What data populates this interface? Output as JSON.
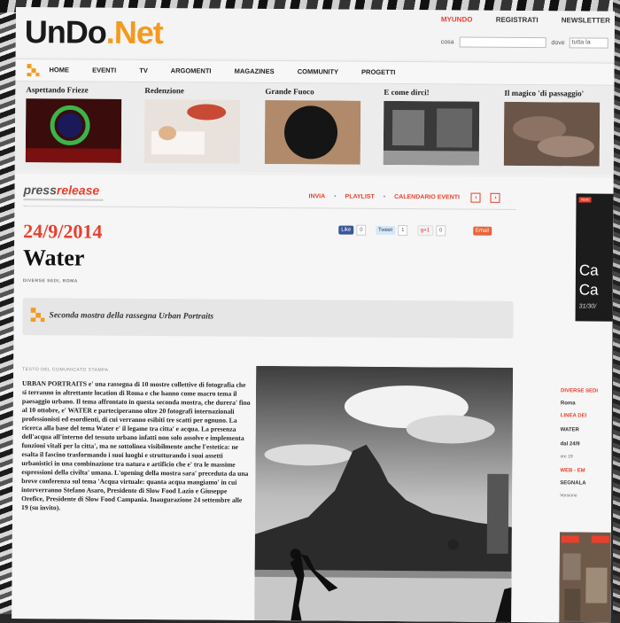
{
  "header": {
    "logo_main": "UnDo",
    "logo_suffix": ".Net",
    "top_links": [
      "MYUNDO",
      "REGISTRATI",
      "NEWSLETTER"
    ],
    "search_label": "cosa",
    "where_label": "dove",
    "where_value": "tutta la"
  },
  "nav": {
    "items": [
      "HOME",
      "EVENTI",
      "TV",
      "ARGOMENTI",
      "MAGAZINES",
      "COMMUNITY",
      "PROGETTI"
    ]
  },
  "features": [
    {
      "title": "Aspettando Frieze"
    },
    {
      "title": "Redenzione"
    },
    {
      "title": "Grande Fuoco"
    },
    {
      "title": "E come dirci!"
    },
    {
      "title": "Il magico 'di passaggio'"
    }
  ],
  "press": {
    "brand_a": "press",
    "brand_b": "release",
    "actions": [
      "INVIA",
      "PLAYLIST",
      "CALENDARIO EVENTI"
    ]
  },
  "article": {
    "date": "24/9/2014",
    "title": "Water",
    "place": "DIVERSE SEDI, ROMA",
    "subtitle": "Seconda mostra della rassegna Urban Portraits",
    "comm_label": "TESTO DEL COMUNICATO STAMPA",
    "body": "URBAN PORTRAITS e' una rassegna di 10 mostre collettive di fotografia che si terranno in altrettante location di Roma e che hanno come macro tema il paesaggio urbano. Il tema affrontato in questa seconda mostra, che durera' fino al 10 ottobre, e' WATER e parteciperanno oltre 20 fotografi internazionali professionisti ed esordienti, di cui verranno esibiti tre scatti per ognuno. La ricerca alla base del tema Water e' il legame tra citta' e acqua. La presenza dell'acqua all'interno del tessuto urbano infatti non solo assolve e implementa funzioni vitali per la citta', ma ne sottolinea visibilmente anche l'estetica: ne esalta il fascino trasformando i suoi luoghi e strutturando i suoi assetti urbanistici in una combinazione tra natura e artificio che e' tra le massime espressioni della civilta' umana. L'opening della mostra sara' preceduta da una breve conferenza sul tema 'Acqua virtuale: quanta acqua mangiamo' in cui interverranno Stefano Asaro, Presidente di Slow Food Lazio e Giuseppe Orefice, Presidente di Slow Food Campania. Inaugurazione 24 settembre alle 19 (su invito)."
  },
  "social": {
    "fb_label": "Like",
    "fb_count": "0",
    "tw_label": "Tweet",
    "tw_count": "1",
    "gp_label": "g+1",
    "gp_count": "0",
    "mail_label": "Email"
  },
  "right_col": {
    "ad_tag": "Next",
    "ad_caption_1": "Ca",
    "ad_caption_2": "Ca",
    "ad_date": "31/30/",
    "head": "DIVERSE SEDI",
    "lines": [
      "Roma",
      "LINEA DEI",
      "WATER",
      "dal 24/9",
      "ore 19",
      "WEB - EM",
      "SEGNALA",
      "Versione"
    ]
  },
  "colors": {
    "accent": "#e8402d",
    "logo_orange": "#f39a1e"
  }
}
